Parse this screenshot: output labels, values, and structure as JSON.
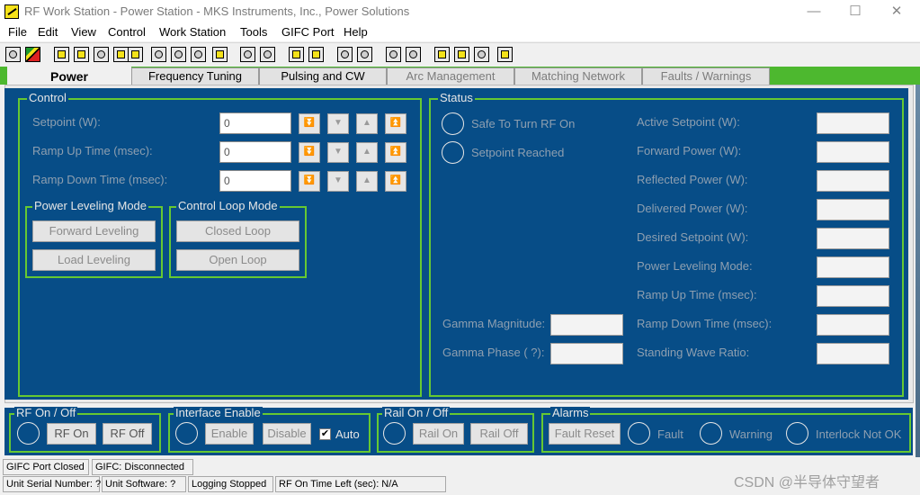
{
  "window": {
    "title": "RF Work Station - Power Station - MKS Instruments, Inc., Power  Solutions",
    "min": "—",
    "max": "☐",
    "close": "✕"
  },
  "menu": [
    "File",
    "Edit",
    "View",
    "Control",
    "Work Station",
    "Tools",
    "GIFC Port",
    "Help"
  ],
  "tabs": [
    "Power",
    "Frequency Tuning",
    "Pulsing and CW",
    "Arc Management",
    "Matching Network",
    "Faults / Warnings"
  ],
  "control": {
    "legend": "Control",
    "rows": [
      {
        "label": "Setpoint (W):",
        "value": "0"
      },
      {
        "label": "Ramp Up Time (msec):",
        "value": "0"
      },
      {
        "label": "Ramp Down Time (msec):",
        "value": "0"
      }
    ],
    "arrows": [
      "⏬",
      "▼",
      "▲",
      "⏫"
    ],
    "power_leveling": {
      "legend": "Power Leveling Mode",
      "forward": "Forward Leveling",
      "load": "Load Leveling"
    },
    "control_loop": {
      "legend": "Control Loop Mode",
      "closed": "Closed Loop",
      "open": "Open Loop"
    }
  },
  "status": {
    "legend": "Status",
    "safe": "Safe To Turn RF On",
    "reached": "Setpoint Reached",
    "gamma_mag": "Gamma Magnitude:",
    "gamma_phase": "Gamma Phase ( ?):",
    "fields": [
      "Active Setpoint (W):",
      "Forward Power (W):",
      "Reflected Power (W):",
      "Delivered Power (W):",
      "Desired Setpoint (W):",
      "Power Leveling Mode:",
      "Ramp Up Time (msec):",
      "Ramp Down Time (msec):",
      "Standing Wave Ratio:"
    ]
  },
  "rf": {
    "legend": "RF On / Off",
    "on": "RF On",
    "off": "RF Off"
  },
  "iface": {
    "legend": "Interface Enable",
    "enable": "Enable",
    "disable": "Disable",
    "auto": "Auto",
    "auto_checked": "✔"
  },
  "rail": {
    "legend": "Rail On / Off",
    "on": "Rail On",
    "off": "Rail Off"
  },
  "alarms": {
    "legend": "Alarms",
    "reset": "Fault Reset",
    "fault": "Fault",
    "warning": "Warning",
    "interlock": "Interlock Not OK"
  },
  "statusbar": {
    "port": "GIFC Port Closed",
    "conn": "GIFC: Disconnected",
    "serial": "Unit Serial Number: ?",
    "software": "Unit Software: ?",
    "logging": "Logging Stopped",
    "rftime": "RF On Time Left (sec): N/A"
  },
  "watermark": "CSDN @半导体守望者",
  "colors": {
    "panel": "#074d87",
    "accent": "#66c832",
    "tabstrip": "#4db82f"
  }
}
